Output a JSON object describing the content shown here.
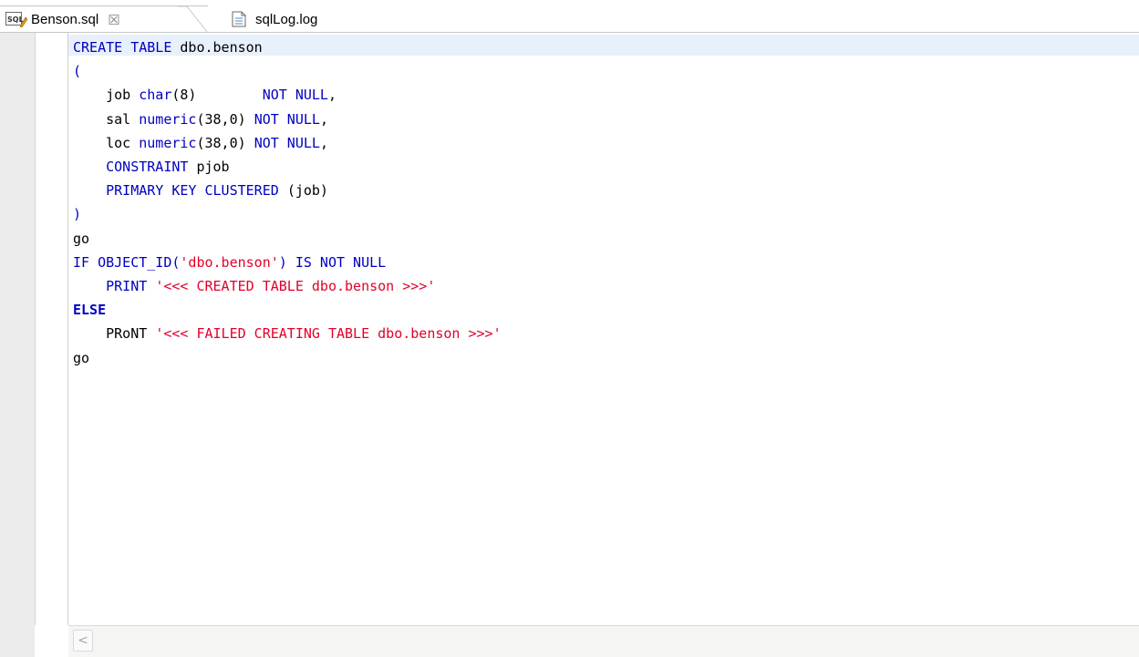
{
  "tabs": [
    {
      "label": "Benson.sql",
      "icon": "sql-file-icon",
      "close": "☒",
      "active": true
    },
    {
      "label": "sqlLog.log",
      "icon": "log-file-icon",
      "active": false
    }
  ],
  "editor": {
    "lines": [
      [
        {
          "t": "CREATE TABLE ",
          "c": "kw"
        },
        {
          "t": "dbo.benson",
          "c": "dflt"
        }
      ],
      [
        {
          "t": "(",
          "c": "kw"
        }
      ],
      [
        {
          "t": "    job ",
          "c": "dflt"
        },
        {
          "t": "char",
          "c": "kw"
        },
        {
          "t": "(8)        ",
          "c": "dflt"
        },
        {
          "t": "NOT NULL",
          "c": "kw"
        },
        {
          "t": ",",
          "c": "dflt"
        }
      ],
      [
        {
          "t": "    sal ",
          "c": "dflt"
        },
        {
          "t": "numeric",
          "c": "kw"
        },
        {
          "t": "(38,0) ",
          "c": "dflt"
        },
        {
          "t": "NOT NULL",
          "c": "kw"
        },
        {
          "t": ",",
          "c": "dflt"
        }
      ],
      [
        {
          "t": "    loc ",
          "c": "dflt"
        },
        {
          "t": "numeric",
          "c": "kw"
        },
        {
          "t": "(38,0) ",
          "c": "dflt"
        },
        {
          "t": "NOT NULL",
          "c": "kw"
        },
        {
          "t": ",",
          "c": "dflt"
        }
      ],
      [
        {
          "t": "    CONSTRAINT ",
          "c": "kw"
        },
        {
          "t": "pjob",
          "c": "dflt"
        }
      ],
      [
        {
          "t": "    PRIMARY KEY CLUSTERED ",
          "c": "kw"
        },
        {
          "t": "(job)",
          "c": "dflt"
        }
      ],
      [
        {
          "t": ")",
          "c": "kw"
        }
      ],
      [
        {
          "t": "go",
          "c": "dflt"
        }
      ],
      [
        {
          "t": "IF OBJECT_ID(",
          "c": "kw"
        },
        {
          "t": "'dbo.benson'",
          "c": "str"
        },
        {
          "t": ") IS NOT NULL",
          "c": "kw"
        }
      ],
      [
        {
          "t": "    PRINT ",
          "c": "kw"
        },
        {
          "t": "'<<< CREATED TABLE dbo.benson >>>'",
          "c": "str"
        }
      ],
      [
        {
          "t": "ELSE",
          "c": "kw bold"
        }
      ],
      [
        {
          "t": "    PRoNT ",
          "c": "dflt"
        },
        {
          "t": "'<<< FAILED CREATING TABLE dbo.benson >>>'",
          "c": "str"
        }
      ],
      [
        {
          "t": "go",
          "c": "dflt"
        }
      ]
    ]
  },
  "scrollbar": {
    "left_arrow": "<"
  },
  "colors": {
    "keyword": "#0000c0",
    "string": "#e3002a",
    "current_line": "#e8f0fc"
  }
}
